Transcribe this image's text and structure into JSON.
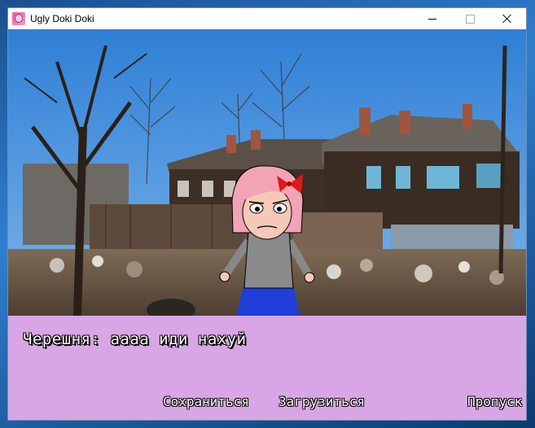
{
  "window": {
    "title": "Ugly Doki Doki",
    "app_icon": "app-icon"
  },
  "dialog": {
    "speaker": "Черешня",
    "line": "Черешня: аааа иди нахуй"
  },
  "menu": {
    "save_label": "Сохраниться",
    "load_label": "Загрузиться",
    "skip_label": "Пропуск"
  },
  "colors": {
    "dialog_bg": "#d8a6e4",
    "sky": "#3f8ee0",
    "hair": "#f3a3b6",
    "bow": "#e01818",
    "skirt": "#1f3fd8",
    "sweater": "#8a8a8a"
  }
}
